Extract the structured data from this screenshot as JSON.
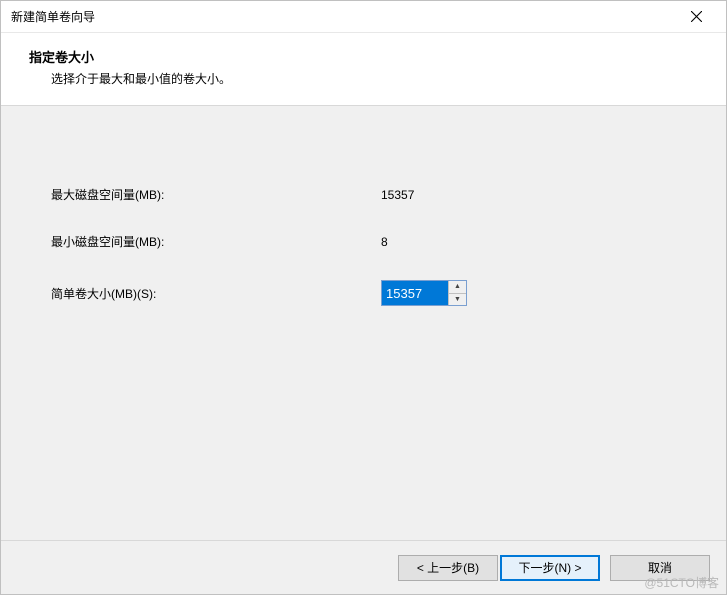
{
  "window": {
    "title": "新建简单卷向导",
    "close_label": "关闭"
  },
  "header": {
    "heading": "指定卷大小",
    "subheading": "选择介于最大和最小值的卷大小。"
  },
  "fields": {
    "max_disk_label": "最大磁盘空间量(MB):",
    "max_disk_value": "15357",
    "min_disk_label": "最小磁盘空间量(MB):",
    "min_disk_value": "8",
    "size_label": "简单卷大小(MB)(S):",
    "size_value": "15357"
  },
  "buttons": {
    "back": "< 上一步(B)",
    "next": "下一步(N) >",
    "cancel": "取消"
  },
  "watermark": "@51CTO博客"
}
